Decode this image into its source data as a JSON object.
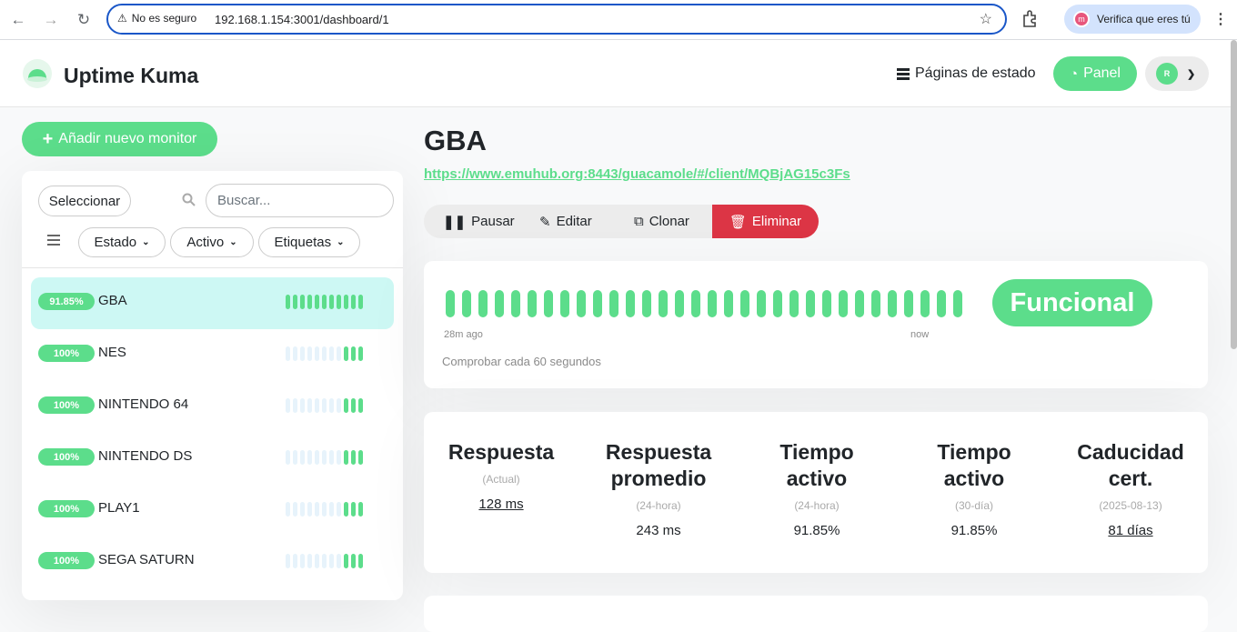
{
  "browser": {
    "warning": "No es seguro",
    "url": "192.168.1.154:3001/dashboard/1",
    "verify_label": "Verifica que eres tú",
    "verify_avatar": "m"
  },
  "header": {
    "brand": "Uptime Kuma",
    "status_pages_label": "Páginas de estado",
    "panel_label": "Panel",
    "profile_initial": "R"
  },
  "sidebar": {
    "add_button_label": "Añadir nuevo monitor",
    "select_label": "Seleccionar",
    "search_placeholder": "Buscar...",
    "filters": [
      "Estado",
      "Activo",
      "Etiquetas"
    ],
    "monitors": [
      {
        "uptime": "91.85%",
        "name": "GBA",
        "filled_beats": 11
      },
      {
        "uptime": "100%",
        "name": "NES",
        "filled_beats": 3
      },
      {
        "uptime": "100%",
        "name": "NINTENDO 64",
        "filled_beats": 3
      },
      {
        "uptime": "100%",
        "name": "NINTENDO DS",
        "filled_beats": 3
      },
      {
        "uptime": "100%",
        "name": "PLAY1",
        "filled_beats": 3
      },
      {
        "uptime": "100%",
        "name": "SEGA SATURN",
        "filled_beats": 3
      }
    ]
  },
  "main": {
    "title": "GBA",
    "url": "https://www.emuhub.org:8443/guacamole/#/client/MQBjAG15c3Fs",
    "actions": {
      "pause": "Pausar",
      "edit": "Editar",
      "clone": "Clonar",
      "delete": "Eliminar"
    },
    "beats": {
      "count": 32,
      "left_label": "28m ago",
      "right_label": "now",
      "interval": "Comprobar cada 60 segundos"
    },
    "status": "Funcional",
    "stats": [
      {
        "title": "Respuesta",
        "sub": "(Actual)",
        "value": "128 ms",
        "link": true
      },
      {
        "title": "Respuesta promedio",
        "sub": "(24-hora)",
        "value": "243 ms",
        "link": false
      },
      {
        "title": "Tiempo activo",
        "sub": "(24-hora)",
        "value": "91.85%",
        "link": false
      },
      {
        "title": "Tiempo activo",
        "sub": "(30-día)",
        "value": "91.85%",
        "link": false
      },
      {
        "title": "Caducidad cert.",
        "sub": "(2025-08-13)",
        "value": "81 días",
        "link": true
      }
    ]
  },
  "colors": {
    "accent": "#5cdd8b",
    "danger": "#dc3545",
    "active_row": "#cdf8f4"
  }
}
